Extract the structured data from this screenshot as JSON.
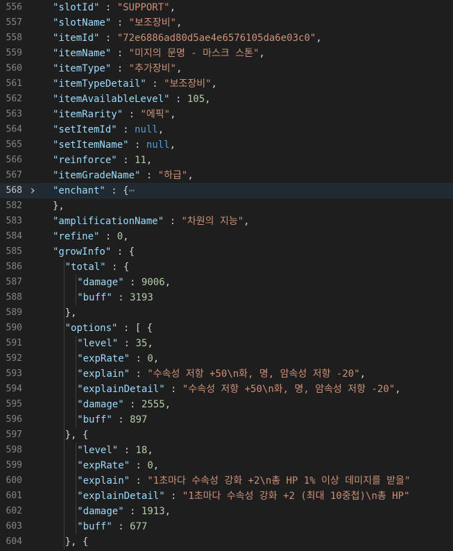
{
  "editor": {
    "fold_marker_icon": "chevron-right-icon",
    "ellipsis": "⋯",
    "colors": {
      "background": "#1e1e1e",
      "key": "#9cdcfe",
      "string": "#ce9178",
      "number": "#b5cea8",
      "null": "#569cd6",
      "punctuation": "#d4d4d4",
      "line_number": "#858585"
    },
    "lines": [
      {
        "n": "556",
        "indent": 1,
        "key": "slotId",
        "type": "s",
        "value": "SUPPORT",
        "tail": ","
      },
      {
        "n": "557",
        "indent": 1,
        "key": "slotName",
        "type": "s",
        "value": "보조장비",
        "tail": ","
      },
      {
        "n": "558",
        "indent": 1,
        "key": "itemId",
        "type": "s",
        "value": "72e6886ad80d5ae4e6576105da6e03c0",
        "tail": ","
      },
      {
        "n": "559",
        "indent": 1,
        "key": "itemName",
        "type": "s",
        "value": "미지의 문명 - 마스크 스톤",
        "tail": ","
      },
      {
        "n": "560",
        "indent": 1,
        "key": "itemType",
        "type": "s",
        "value": "추가장비",
        "tail": ","
      },
      {
        "n": "561",
        "indent": 1,
        "key": "itemTypeDetail",
        "type": "s",
        "value": "보조장비",
        "tail": ","
      },
      {
        "n": "562",
        "indent": 1,
        "key": "itemAvailableLevel",
        "type": "n",
        "value": "105",
        "tail": ","
      },
      {
        "n": "563",
        "indent": 1,
        "key": "itemRarity",
        "type": "s",
        "value": "에픽",
        "tail": ","
      },
      {
        "n": "564",
        "indent": 1,
        "key": "setItemId",
        "type": "u",
        "value": "null",
        "tail": ","
      },
      {
        "n": "565",
        "indent": 1,
        "key": "setItemName",
        "type": "u",
        "value": "null",
        "tail": ","
      },
      {
        "n": "566",
        "indent": 1,
        "key": "reinforce",
        "type": "n",
        "value": "11",
        "tail": ","
      },
      {
        "n": "567",
        "indent": 1,
        "key": "itemGradeName",
        "type": "s",
        "value": "하급",
        "tail": ","
      },
      {
        "n": "568",
        "indent": 1,
        "key": "enchant",
        "type": "o",
        "value": "{",
        "folded": true,
        "active": true
      },
      {
        "n": "582",
        "indent": 1,
        "type": "raw",
        "value": "},"
      },
      {
        "n": "583",
        "indent": 1,
        "key": "amplificationName",
        "type": "s",
        "value": "차원의 지능",
        "tail": ","
      },
      {
        "n": "584",
        "indent": 1,
        "key": "refine",
        "type": "n",
        "value": "0",
        "tail": ","
      },
      {
        "n": "585",
        "indent": 1,
        "key": "growInfo",
        "type": "o",
        "value": "{"
      },
      {
        "n": "586",
        "indent": 2,
        "key": "total",
        "type": "o",
        "value": "{"
      },
      {
        "n": "587",
        "indent": 3,
        "key": "damage",
        "type": "n",
        "value": "9006",
        "tail": ","
      },
      {
        "n": "588",
        "indent": 3,
        "key": "buff",
        "type": "n",
        "value": "3193",
        "tail": ""
      },
      {
        "n": "589",
        "indent": 2,
        "type": "raw",
        "value": "},"
      },
      {
        "n": "590",
        "indent": 2,
        "key": "options",
        "type": "o",
        "value": "[ {"
      },
      {
        "n": "591",
        "indent": 3,
        "key": "level",
        "type": "n",
        "value": "35",
        "tail": ","
      },
      {
        "n": "592",
        "indent": 3,
        "key": "expRate",
        "type": "n",
        "value": "0",
        "tail": ","
      },
      {
        "n": "593",
        "indent": 3,
        "key": "explain",
        "type": "s",
        "value": "수속성 저항 +50\\n화, 명, 암속성 저항 -20",
        "tail": ","
      },
      {
        "n": "594",
        "indent": 3,
        "key": "explainDetail",
        "type": "s",
        "value": "수속성 저항 +50\\n화, 명, 암속성 저항 -20",
        "tail": ","
      },
      {
        "n": "595",
        "indent": 3,
        "key": "damage",
        "type": "n",
        "value": "2555",
        "tail": ","
      },
      {
        "n": "596",
        "indent": 3,
        "key": "buff",
        "type": "n",
        "value": "897",
        "tail": ""
      },
      {
        "n": "597",
        "indent": 2,
        "type": "raw",
        "value": "}, {"
      },
      {
        "n": "598",
        "indent": 3,
        "key": "level",
        "type": "n",
        "value": "18",
        "tail": ","
      },
      {
        "n": "599",
        "indent": 3,
        "key": "expRate",
        "type": "n",
        "value": "0",
        "tail": ","
      },
      {
        "n": "600",
        "indent": 3,
        "key": "explain",
        "type": "s",
        "value": "1초마다 수속성 강화 +2\\n총 HP 1% 이상 데미지를 받을",
        "tail": ""
      },
      {
        "n": "601",
        "indent": 3,
        "key": "explainDetail",
        "type": "s",
        "value": "1초마다 수속성 강화 +2 (최대 10중첩)\\n총 HP",
        "tail": ""
      },
      {
        "n": "602",
        "indent": 3,
        "key": "damage",
        "type": "n",
        "value": "1913",
        "tail": ","
      },
      {
        "n": "603",
        "indent": 3,
        "key": "buff",
        "type": "n",
        "value": "677",
        "tail": ""
      },
      {
        "n": "604",
        "indent": 2,
        "type": "raw",
        "value": "}, {"
      }
    ]
  }
}
